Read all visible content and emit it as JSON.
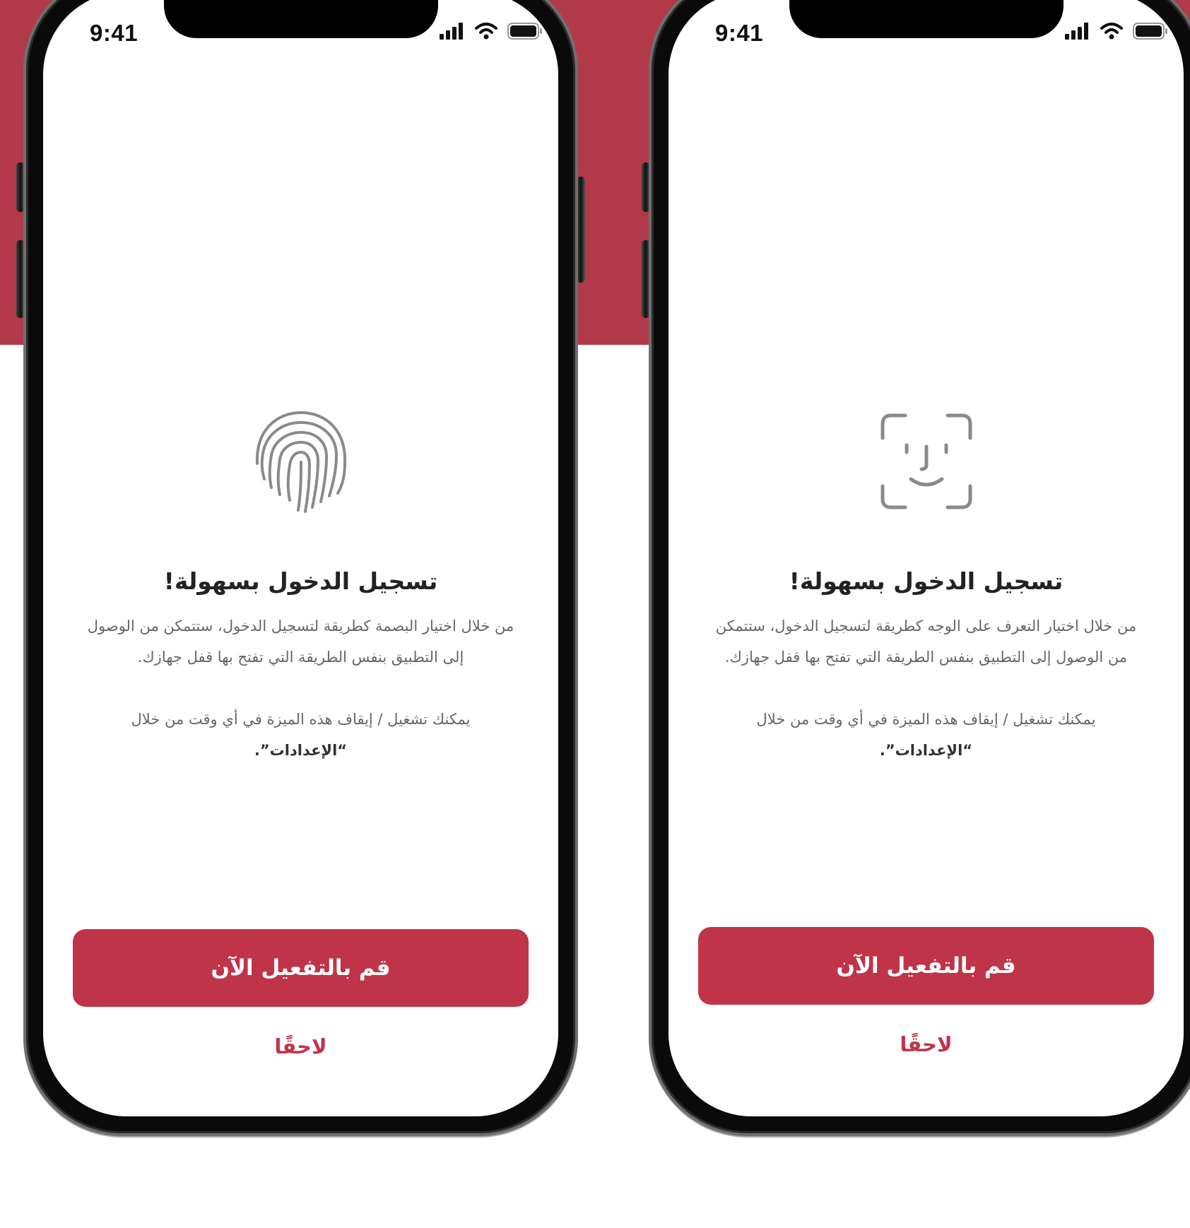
{
  "colors": {
    "brand": "#c0344a",
    "band": "#b23a48",
    "text_primary": "#222222",
    "text_secondary": "#666666"
  },
  "phones": [
    {
      "variant": "fingerprint",
      "status_bar": {
        "time": "9:41",
        "icons": [
          "signal-icon",
          "wifi-icon",
          "battery-icon"
        ]
      },
      "illustration": "fingerprint-icon",
      "title": "تسجيل الدخول بسهولة!",
      "description": "من خلال اختيار البصمة كطريقة لتسجيل الدخول، ستتمكن من الوصول إلى التطبيق بنفس الطريقة التي تفتح بها قفل جهازك.",
      "settings_note_prefix": "يمكنك تشغيل / إيقاف هذه الميزة في أي وقت من خلال ",
      "settings_link": "“الإعدادات”.",
      "primary_button": "قم بالتفعيل الآن",
      "later_link": "لاحقًا"
    },
    {
      "variant": "face",
      "status_bar": {
        "time": "9:41",
        "icons": [
          "signal-icon",
          "wifi-icon",
          "battery-icon"
        ]
      },
      "illustration": "face-id-icon",
      "title": "تسجيل الدخول بسهولة!",
      "description": "من خلال اختيار التعرف على الوجه كطريقة لتسجيل الدخول، ستتمكن من الوصول إلى التطبيق بنفس الطريقة التي تفتح بها قفل جهازك.",
      "settings_note_prefix": "يمكنك تشغيل / إيقاف هذه الميزة في أي وقت من خلال ",
      "settings_link": "“الإعدادات”.",
      "primary_button": "قم بالتفعيل الآن",
      "later_link": "لاحقًا"
    }
  ]
}
